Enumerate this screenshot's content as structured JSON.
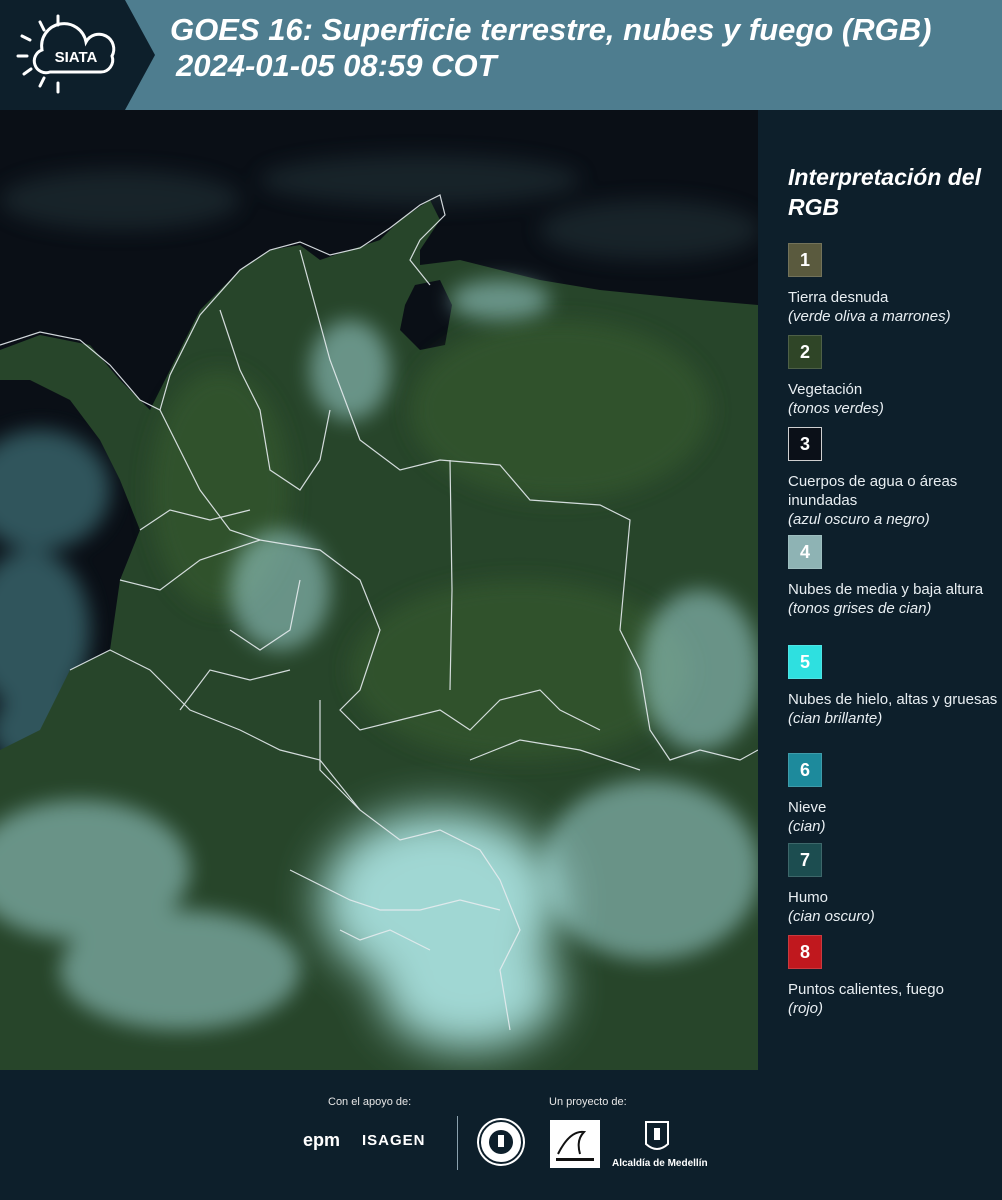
{
  "header": {
    "logo_text": "SIATA",
    "title_line1": "GOES 16: Superficie terrestre, nubes y fuego (RGB)",
    "title_line2": "2024-01-05 08:59 COT"
  },
  "legend": {
    "title": "Interpretación del RGB",
    "items": [
      {
        "num": "1",
        "name": "Tierra desnuda",
        "desc": "(verde oliva a marrones)",
        "color": "#5a5a3e"
      },
      {
        "num": "2",
        "name": "Vegetación",
        "desc": "(tonos verdes)",
        "color": "#2f4527"
      },
      {
        "num": "3",
        "name": "Cuerpos de agua o áreas inundadas",
        "desc": "(azul oscuro a negro)",
        "color": "#0b1018"
      },
      {
        "num": "4",
        "name": "Nubes de media y baja altura",
        "desc": "(tonos grises de cian)",
        "color": "#8eb3b4"
      },
      {
        "num": "5",
        "name": "Nubes de hielo, altas y gruesas",
        "desc": "(cian brillante)",
        "color": "#2ee0e0"
      },
      {
        "num": "6",
        "name": "Nieve",
        "desc": "(cian)",
        "color": "#1d8a9c"
      },
      {
        "num": "7",
        "name": "Humo",
        "desc": "(cian oscuro)",
        "color": "#1c4d50"
      },
      {
        "num": "8",
        "name": "Puntos calientes, fuego",
        "desc": "(rojo)",
        "color": "#c0181e"
      }
    ]
  },
  "footer": {
    "support_label": "Con el apoyo de:",
    "project_label": "Un proyecto de:",
    "sponsors": [
      "epm",
      "ISAGEN"
    ],
    "partners": [
      "Área Metropolitana Valle de Aburrá",
      "Alcaldía de Medellín"
    ],
    "alcaldia_label": "Alcaldía de Medellín"
  },
  "colors": {
    "header_bg": "#4e7d8f",
    "background": "#0d1f2b",
    "ocean": "#0a0f16",
    "land": "#2b4a2c",
    "cloud": "#7fd6d6"
  }
}
